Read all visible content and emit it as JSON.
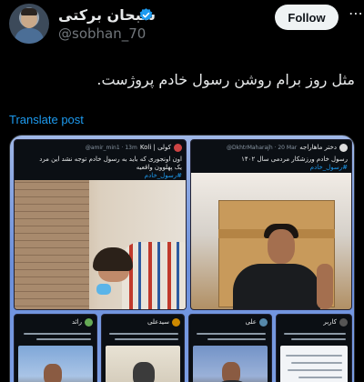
{
  "header": {
    "display_name": "سبحان برکتی",
    "handle": "@sobhan_70",
    "follow_label": "Follow",
    "more_glyph": "⋯"
  },
  "tweet": {
    "text": "مثل روز برام روشن رسول خادم پروژست.",
    "translate_label": "Translate post"
  },
  "media": {
    "card1": {
      "name": "Koli | كولى",
      "handle": "@amir_min1 · 13m",
      "text": "اون اونجوری که باید به رسول خادم توجه نشد این مرد",
      "text2": "یک پهلوون واقعیه",
      "hashtag": "#رسول_خادم"
    },
    "card2": {
      "name": "دختر ماهاراجه",
      "handle": "@DkhtrMaharajh · 20 Mar",
      "text": "رسول خادم ورزشکار مردمی سال ۱۴۰۲",
      "hashtag": "#رسول_خادم"
    },
    "card3": {
      "name": "رائد"
    },
    "card4": {
      "name": "سیدعلی"
    },
    "card5": {
      "name": "علی"
    },
    "card6": {
      "name": "کاربر"
    }
  },
  "colors": {
    "background": "#000000",
    "text": "#e7e9ea",
    "secondary": "#71767b",
    "accent": "#1d9bf0",
    "follow_bg": "#eff3f4"
  },
  "icons": [
    "verified-badge-icon",
    "more-icon"
  ]
}
